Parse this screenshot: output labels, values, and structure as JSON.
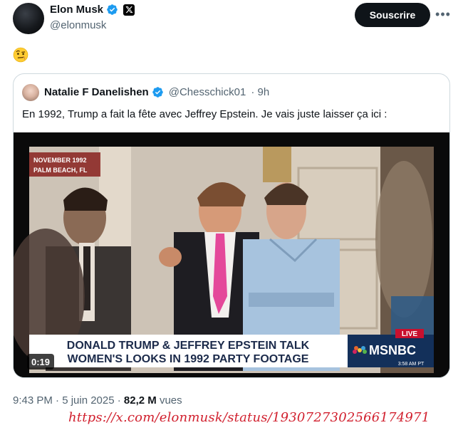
{
  "tweet": {
    "author_name": "Elon Musk",
    "author_handle": "@elonmusk",
    "subscribe_label": "Souscrire",
    "more_label": "•••",
    "body_emoji": "🤨",
    "timestamp": "9:43 PM · 5 juin 2025 · ",
    "views_count": "82,2 M",
    "views_label": " vues"
  },
  "quoted_tweet": {
    "author_name": "Natalie F Danelishen",
    "author_handle": "@Chesschick01",
    "age": "· 9h",
    "text": "En 1992, Trump a fait la fête avec Jeffrey Epstein. Je vais juste laisser ça ici :",
    "video": {
      "duration": "0:19",
      "date_overlay_line1": "NOVEMBER 1992",
      "date_overlay_line2": "PALM BEACH, FL",
      "headline_line1": "DONALD TRUMP & JEFFREY EPSTEIN TALK",
      "headline_line2": "WOMEN'S LOOKS IN 1992 PARTY FOOTAGE",
      "live_label": "LIVE",
      "network": "MSNBC",
      "clock": "3:58 AM PT"
    }
  },
  "source_url": "https://x.com/elonmusk/status/1930727302566174971",
  "colors": {
    "verified_blue": "#1d9bf0",
    "text_primary": "#0f1419",
    "text_secondary": "#536471",
    "url_red": "#d1202e",
    "msnbc_live_red": "#c8102e"
  },
  "icons": {
    "verified": "verified-badge-icon",
    "x_logo": "x-logo-icon",
    "more": "more-icon"
  }
}
